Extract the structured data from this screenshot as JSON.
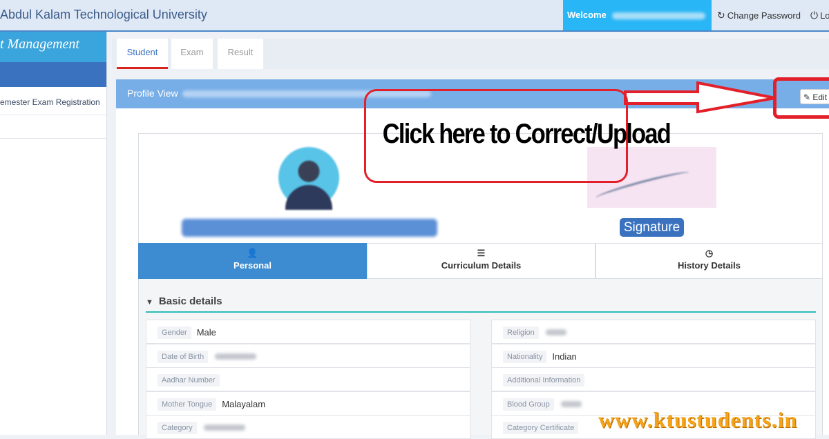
{
  "header": {
    "app_title": "Abdul Kalam Technological University",
    "welcome": "Welcome",
    "change_password": "Change Password",
    "logout": "Lo"
  },
  "sidebar": {
    "heading": "t Management",
    "items": [
      {
        "label": "emester Exam Registration"
      }
    ]
  },
  "tabs": [
    {
      "label": "Student",
      "active": true
    },
    {
      "label": "Exam"
    },
    {
      "label": "Result"
    }
  ],
  "profile": {
    "title": "Profile View",
    "edit_label": "Edit",
    "signature_label": "Signature"
  },
  "annotation": {
    "callout_text": "Click here to Correct/Upload",
    "color": "#e3202a"
  },
  "subtabs": [
    {
      "label": "Personal",
      "icon": "user-icon",
      "active": true
    },
    {
      "label": "Curriculum Details",
      "icon": "list-icon"
    },
    {
      "label": "History Details",
      "icon": "clock-icon"
    }
  ],
  "basic": {
    "heading": "Basic details",
    "left": [
      {
        "label": "Gender",
        "value": "Male"
      },
      {
        "label": "Date of Birth",
        "value": ""
      },
      {
        "label": "Aadhar Number",
        "value": ""
      },
      {
        "label": "Mother Tongue",
        "value": "Malayalam"
      },
      {
        "label": "Category",
        "value": ""
      }
    ],
    "right": [
      {
        "label": "Religion",
        "value": ""
      },
      {
        "label": "Nationality",
        "value": "Indian"
      },
      {
        "label": "Additional Information",
        "value": ""
      },
      {
        "label": "Blood Group",
        "value": ""
      },
      {
        "label": "Category Certificate",
        "value": ""
      }
    ]
  },
  "watermark": "www.ktustudents.in",
  "colors": {
    "accent": "#3a72c0",
    "header_blue": "#78aee8",
    "welcome_bg": "#29b6f6"
  }
}
